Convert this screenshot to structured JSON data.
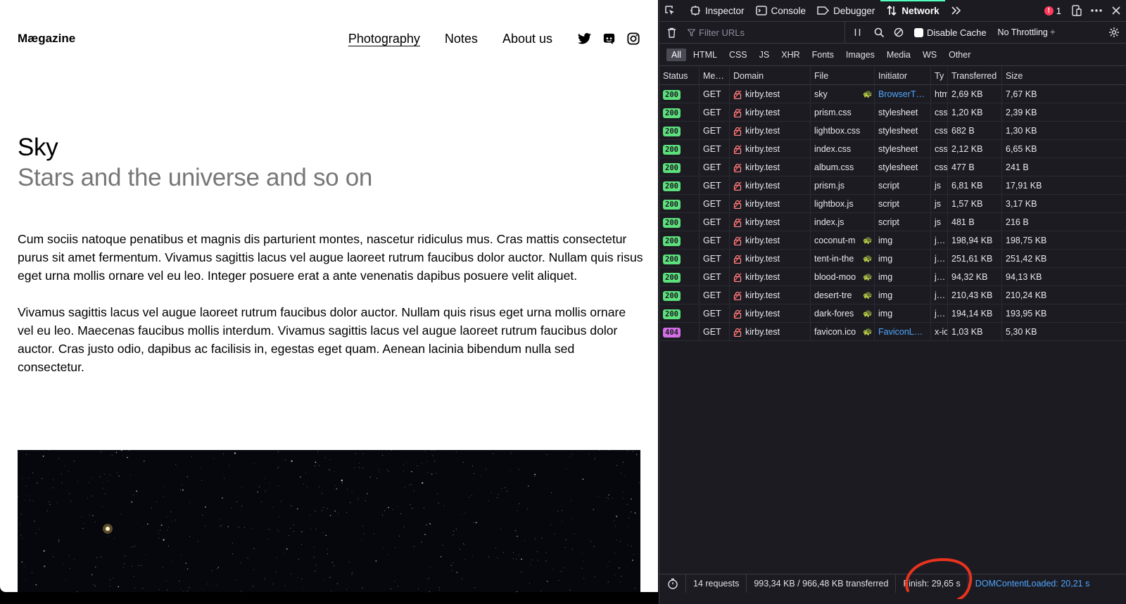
{
  "site": {
    "logo": "Mægazine",
    "nav": [
      "Photography",
      "Notes",
      "About us"
    ],
    "active_nav": "Photography",
    "social_icons": [
      "twitter-icon",
      "discord-icon",
      "instagram-icon"
    ],
    "title": "Sky",
    "subtitle": "Stars and the universe and so on",
    "paragraphs": [
      "Cum sociis natoque penatibus et magnis dis parturient montes, nascetur ridiculus mus. Cras mattis consectetur purus sit amet fermentum. Vivamus sagittis lacus vel augue laoreet rutrum faucibus dolor auctor. Nullam quis risus eget urna mollis ornare vel eu leo. Integer posuere erat a ante venenatis dapibus posuere velit aliquet.",
      "Vivamus sagittis lacus vel augue laoreet rutrum faucibus dolor auctor. Nullam quis risus eget urna mollis ornare vel eu leo. Maecenas faucibus mollis interdum. Vivamus sagittis lacus vel augue laoreet rutrum faucibus dolor auctor. Cras justo odio, dapibus ac facilisis in, egestas eget quam. Aenean lacinia bibendum nulla sed consectetur."
    ]
  },
  "devtools": {
    "tabs": [
      "Inspector",
      "Console",
      "Debugger",
      "Network"
    ],
    "active_tab": "Network",
    "error_count": "1",
    "filter_placeholder": "Filter URLs",
    "disable_cache_label": "Disable Cache",
    "throttling": "No Throttling ÷",
    "type_filters": [
      "All",
      "HTML",
      "CSS",
      "JS",
      "XHR",
      "Fonts",
      "Images",
      "Media",
      "WS",
      "Other"
    ],
    "active_type_filter": "All",
    "columns": [
      "Status",
      "Me…",
      "Domain",
      "File",
      "Initiator",
      "Ty",
      "Transferred",
      "Size"
    ],
    "rows": [
      {
        "status": "200",
        "method": "GET",
        "domain": "kirby.test",
        "file": "sky",
        "throttled": true,
        "initiator": "BrowserT…",
        "initiator_link": true,
        "type": "htm",
        "transferred": "2,69 KB",
        "size": "7,67 KB"
      },
      {
        "status": "200",
        "method": "GET",
        "domain": "kirby.test",
        "file": "prism.css",
        "throttled": false,
        "initiator": "stylesheet",
        "initiator_link": false,
        "type": "css",
        "transferred": "1,20 KB",
        "size": "2,39 KB"
      },
      {
        "status": "200",
        "method": "GET",
        "domain": "kirby.test",
        "file": "lightbox.css",
        "throttled": false,
        "initiator": "stylesheet",
        "initiator_link": false,
        "type": "css",
        "transferred": "682 B",
        "size": "1,30 KB"
      },
      {
        "status": "200",
        "method": "GET",
        "domain": "kirby.test",
        "file": "index.css",
        "throttled": false,
        "initiator": "stylesheet",
        "initiator_link": false,
        "type": "css",
        "transferred": "2,12 KB",
        "size": "6,65 KB"
      },
      {
        "status": "200",
        "method": "GET",
        "domain": "kirby.test",
        "file": "album.css",
        "throttled": false,
        "initiator": "stylesheet",
        "initiator_link": false,
        "type": "css",
        "transferred": "477 B",
        "size": "241 B"
      },
      {
        "status": "200",
        "method": "GET",
        "domain": "kirby.test",
        "file": "prism.js",
        "throttled": false,
        "initiator": "script",
        "initiator_link": false,
        "type": "js",
        "transferred": "6,81 KB",
        "size": "17,91 KB"
      },
      {
        "status": "200",
        "method": "GET",
        "domain": "kirby.test",
        "file": "lightbox.js",
        "throttled": false,
        "initiator": "script",
        "initiator_link": false,
        "type": "js",
        "transferred": "1,57 KB",
        "size": "3,17 KB"
      },
      {
        "status": "200",
        "method": "GET",
        "domain": "kirby.test",
        "file": "index.js",
        "throttled": false,
        "initiator": "script",
        "initiator_link": false,
        "type": "js",
        "transferred": "481 B",
        "size": "216 B"
      },
      {
        "status": "200",
        "method": "GET",
        "domain": "kirby.test",
        "file": "coconut-m",
        "throttled": true,
        "initiator": "img",
        "initiator_link": false,
        "type": "j…",
        "transferred": "198,94 KB",
        "size": "198,75 KB"
      },
      {
        "status": "200",
        "method": "GET",
        "domain": "kirby.test",
        "file": "tent-in-the",
        "throttled": true,
        "initiator": "img",
        "initiator_link": false,
        "type": "j…",
        "transferred": "251,61 KB",
        "size": "251,42 KB"
      },
      {
        "status": "200",
        "method": "GET",
        "domain": "kirby.test",
        "file": "blood-moo",
        "throttled": true,
        "initiator": "img",
        "initiator_link": false,
        "type": "j…",
        "transferred": "94,32 KB",
        "size": "94,13 KB"
      },
      {
        "status": "200",
        "method": "GET",
        "domain": "kirby.test",
        "file": "desert-tre",
        "throttled": true,
        "initiator": "img",
        "initiator_link": false,
        "type": "j…",
        "transferred": "210,43 KB",
        "size": "210,24 KB"
      },
      {
        "status": "200",
        "method": "GET",
        "domain": "kirby.test",
        "file": "dark-fores",
        "throttled": true,
        "initiator": "img",
        "initiator_link": false,
        "type": "j…",
        "transferred": "194,14 KB",
        "size": "193,95 KB"
      },
      {
        "status": "404",
        "method": "GET",
        "domain": "kirby.test",
        "file": "favicon.ico",
        "throttled": true,
        "initiator": "FaviconL…",
        "initiator_link": true,
        "type": "x-ic",
        "transferred": "1,03 KB",
        "size": "5,30 KB"
      }
    ],
    "footer": {
      "requests": "14 requests",
      "transferred": "993,34 KB / 966,48 KB transferred",
      "finish": "Finish: 29,65 s",
      "dom_content_loaded": "DOMContentLoaded: 20,21 s"
    },
    "colors": {
      "status_ok": "#5ce07c",
      "status_404": "#d46fe6",
      "link": "#4ea6ff",
      "annotation": "#e8321e"
    }
  }
}
